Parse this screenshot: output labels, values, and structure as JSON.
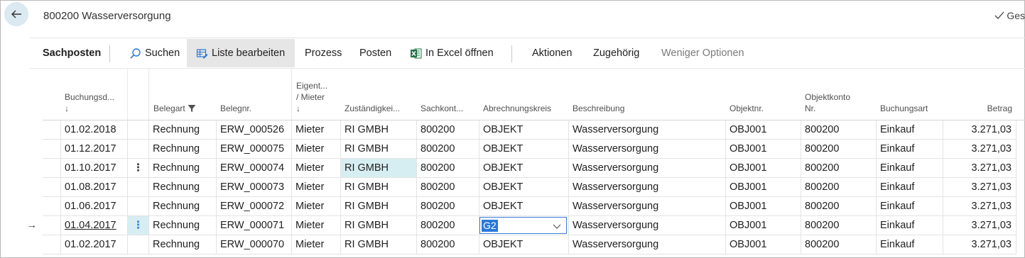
{
  "page": {
    "title": "800200 Wasserversorgung",
    "saved_label": "Ges"
  },
  "actions": {
    "sachposten": "Sachposten",
    "suchen": "Suchen",
    "liste_bearbeiten": "Liste bearbeiten",
    "prozess": "Prozess",
    "posten": "Posten",
    "excel": "In Excel öffnen",
    "aktionen": "Aktionen",
    "zugehoerig": "Zugehörig",
    "weniger": "Weniger Optionen"
  },
  "columns": {
    "buchungsdatum_1": "Buchungsd...",
    "buchungsdatum_2": "↓",
    "belegart": "Belegart",
    "belegnr": "Belegnr.",
    "eigent_1": "Eigent...",
    "eigent_2": "/ Mieter",
    "eigent_3": "↓",
    "zustaendig": "Zuständigkei...",
    "sachkonto": "Sachkont...",
    "abrechnungskreis": "Abrechnungskreis",
    "beschreibung": "Beschreibung",
    "objektnr": "Objektnr.",
    "objektkonto_1": "Objektkonto",
    "objektkonto_2": "Nr.",
    "buchungsart": "Buchungsart",
    "betrag": "Betrag"
  },
  "rows": [
    {
      "datum": "01.02.2018",
      "belegart": "Rechnung",
      "belegnr": "ERW_000526",
      "eigent": "Mieter",
      "zust": "RI GMBH",
      "sachkonto": "800200",
      "abr": "OBJEKT",
      "beschr": "Wasserversorgung",
      "objektnr": "OBJ001",
      "objektkonto": "800200",
      "buchungsart": "Einkauf",
      "betrag": "3.271,03"
    },
    {
      "datum": "01.12.2017",
      "belegart": "Rechnung",
      "belegnr": "ERW_000075",
      "eigent": "Mieter",
      "zust": "RI GMBH",
      "sachkonto": "800200",
      "abr": "OBJEKT",
      "beschr": "Wasserversorgung",
      "objektnr": "OBJ001",
      "objektkonto": "800200",
      "buchungsart": "Einkauf",
      "betrag": "3.271,03"
    },
    {
      "datum": "01.10.2017",
      "belegart": "Rechnung",
      "belegnr": "ERW_000074",
      "eigent": "Mieter",
      "zust": "RI GMBH",
      "sachkonto": "800200",
      "abr": "OBJEKT",
      "beschr": "Wasserversorgung",
      "objektnr": "OBJ001",
      "objektkonto": "800200",
      "buchungsart": "Einkauf",
      "betrag": "3.271,03"
    },
    {
      "datum": "01.08.2017",
      "belegart": "Rechnung",
      "belegnr": "ERW_000073",
      "eigent": "Mieter",
      "zust": "RI GMBH",
      "sachkonto": "800200",
      "abr": "OBJEKT",
      "beschr": "Wasserversorgung",
      "objektnr": "OBJ001",
      "objektkonto": "800200",
      "buchungsart": "Einkauf",
      "betrag": "3.271,03"
    },
    {
      "datum": "01.06.2017",
      "belegart": "Rechnung",
      "belegnr": "ERW_000072",
      "eigent": "Mieter",
      "zust": "RI GMBH",
      "sachkonto": "800200",
      "abr": "OBJEKT",
      "beschr": "Wasserversorgung",
      "objektnr": "OBJ001",
      "objektkonto": "800200",
      "buchungsart": "Einkauf",
      "betrag": "3.271,03"
    },
    {
      "datum": "01.04.2017",
      "belegart": "Rechnung",
      "belegnr": "ERW_000071",
      "eigent": "Mieter",
      "zust": "RI GMBH",
      "sachkonto": "800200",
      "abr": "G2",
      "beschr": "Wasserversorgung",
      "objektnr": "OBJ001",
      "objektkonto": "800200",
      "buchungsart": "Einkauf",
      "betrag": "3.271,03"
    },
    {
      "datum": "01.02.2017",
      "belegart": "Rechnung",
      "belegnr": "ERW_000070",
      "eigent": "Mieter",
      "zust": "RI GMBH",
      "sachkonto": "800200",
      "abr": "OBJEKT",
      "beschr": "Wasserversorgung",
      "objektnr": "OBJ001",
      "objektkonto": "800200",
      "buchungsart": "Einkauf",
      "betrag": "3.271,03"
    }
  ],
  "row_ellipsis": "⋮",
  "current_row_arrow": "→",
  "colors": {
    "accent": "#2b79d8",
    "highlight": "#d6eef2",
    "back_button": "#dbe9f1",
    "excel_green": "#1e7145"
  }
}
